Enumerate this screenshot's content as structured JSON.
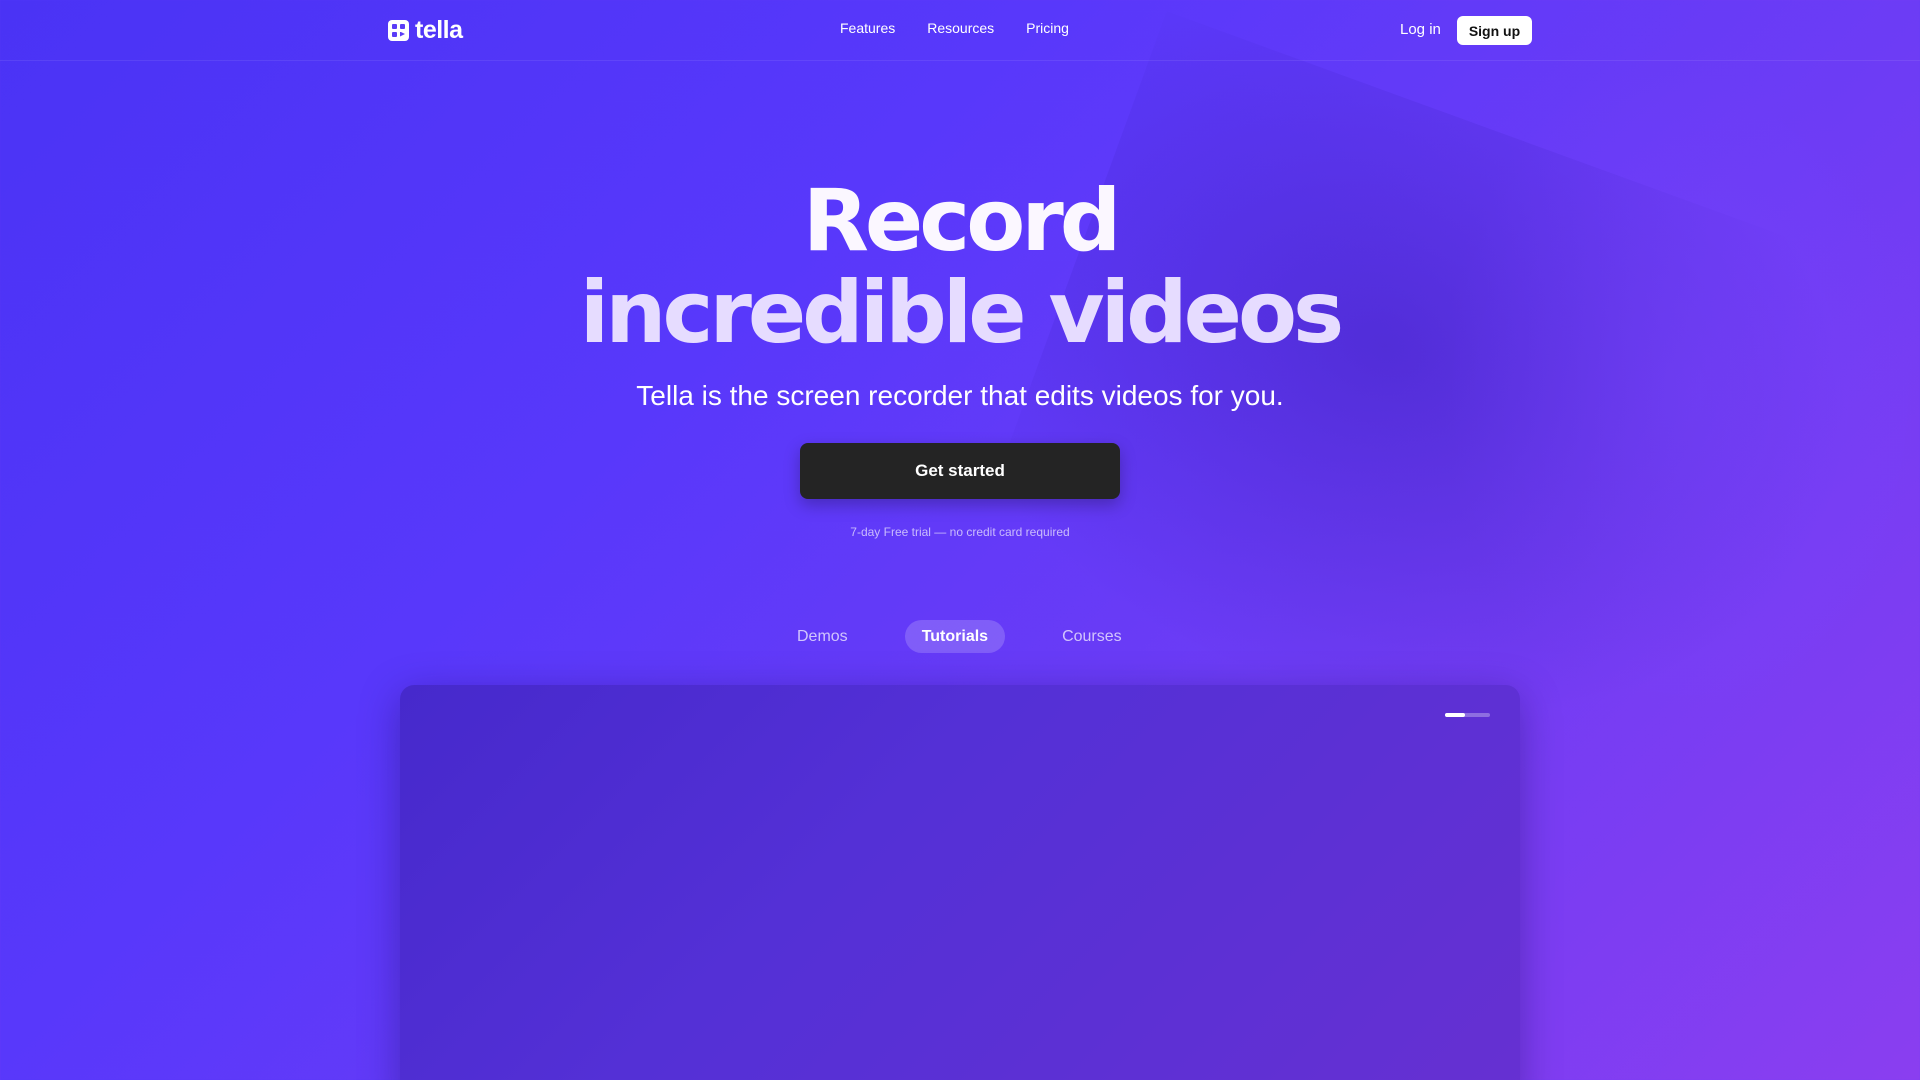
{
  "brand": {
    "name": "tella"
  },
  "nav": {
    "links": [
      "Features",
      "Resources",
      "Pricing"
    ],
    "login": "Log in",
    "signup": "Sign up"
  },
  "hero": {
    "title_line1": "Record",
    "title_line2": "incredible videos",
    "subtitle": "Tella is the screen recorder that edits videos for you.",
    "cta": "Get started",
    "trial_note": "7-day Free trial — no credit card required"
  },
  "tabs": [
    {
      "label": "Demos",
      "active": false
    },
    {
      "label": "Tutorials",
      "active": true
    },
    {
      "label": "Courses",
      "active": false
    }
  ],
  "video": {
    "progress": 0.45
  },
  "colors": {
    "accent": "#5838fb",
    "cta_bg": "#242424"
  }
}
